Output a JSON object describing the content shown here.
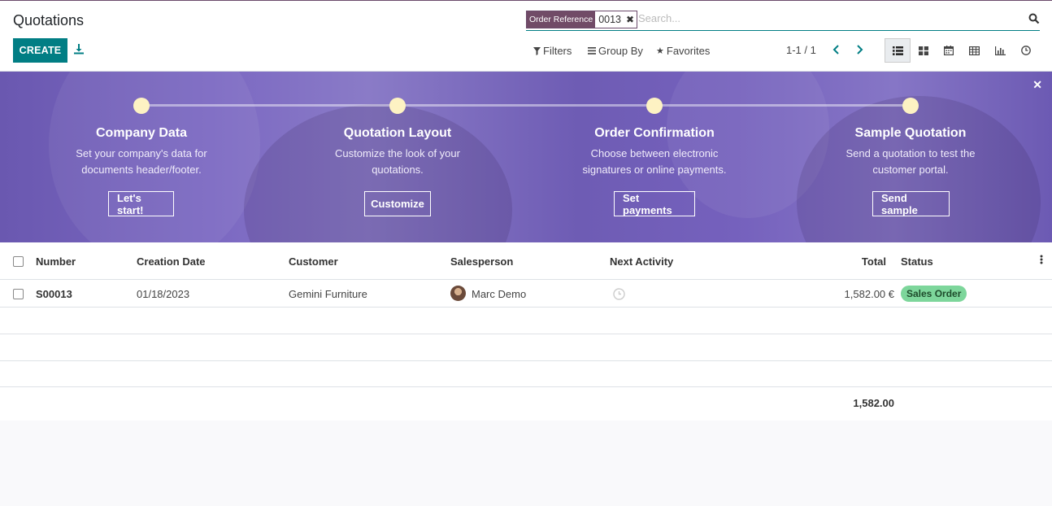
{
  "header": {
    "title": "Quotations",
    "create_label": "CREATE",
    "search": {
      "facet_label": "Order Reference",
      "facet_value": "0013",
      "placeholder": "Search..."
    },
    "filters_label": "Filters",
    "group_by_label": "Group By",
    "favorites_label": "Favorites",
    "pager": "1-1 / 1",
    "views": [
      "list-icon",
      "kanban-icon",
      "calendar-icon",
      "pivot-icon",
      "graph-icon",
      "activity-icon"
    ]
  },
  "banner": {
    "steps": [
      {
        "title": "Company Data",
        "line1": "Set your company's data for",
        "line2": "documents header/footer.",
        "button": "Let's start!"
      },
      {
        "title": "Quotation Layout",
        "line1": "Customize the look of your",
        "line2": "quotations.",
        "button": "Customize"
      },
      {
        "title": "Order Confirmation",
        "line1": "Choose between electronic",
        "line2": "signatures or online payments.",
        "button": "Set payments"
      },
      {
        "title": "Sample Quotation",
        "line1": "Send a quotation to test the",
        "line2": "customer portal.",
        "button": "Send sample"
      }
    ]
  },
  "table": {
    "columns": {
      "number": "Number",
      "creation_date": "Creation Date",
      "customer": "Customer",
      "salesperson": "Salesperson",
      "next_activity": "Next Activity",
      "total": "Total",
      "status": "Status"
    },
    "rows": [
      {
        "number": "S00013",
        "creation_date": "01/18/2023",
        "customer": "Gemini Furniture",
        "salesperson": "Marc Demo",
        "total": "1,582.00 €",
        "status": "Sales Order"
      }
    ],
    "sum_total": "1,582.00"
  },
  "colors": {
    "primary": "#017e84",
    "brand": "#714b67",
    "banner": "#7561bd",
    "status_badge": "#7dd69b"
  }
}
